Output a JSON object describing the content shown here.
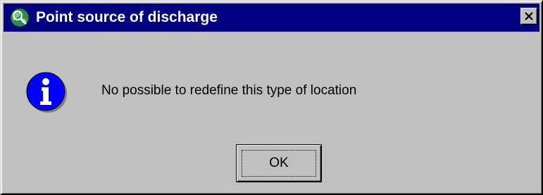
{
  "window": {
    "title": "Point source of discharge",
    "app_icon": "globe-magnifier-icon",
    "close_icon": "close-icon",
    "titlebar_color": "#000080",
    "background_color": "#c0c0c0"
  },
  "dialog": {
    "icon": "info-icon",
    "icon_color": "#0000ff",
    "message": "No possible to redefine this type of location",
    "ok_label": "OK"
  }
}
